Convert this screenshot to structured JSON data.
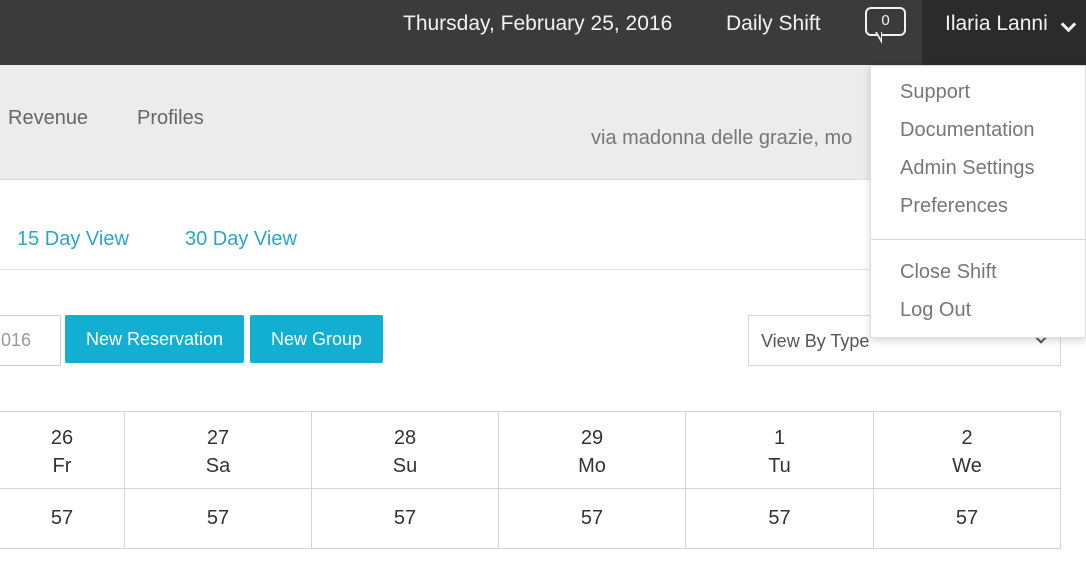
{
  "header": {
    "date": "Thursday, February 25, 2016",
    "shift": "Daily Shift",
    "messages_count": "0",
    "user_name": "Ilaria Lanni"
  },
  "nav": {
    "items": [
      {
        "label": "Revenue"
      },
      {
        "label": "Profiles"
      }
    ],
    "address": "via madonna delle grazie, mo"
  },
  "views": {
    "tabs": [
      {
        "label": "15 Day View"
      },
      {
        "label": "30 Day View"
      }
    ]
  },
  "toolbar": {
    "date_value": "016",
    "new_reservation": "New Reservation",
    "new_group": "New Group",
    "view_select": "View By Type"
  },
  "calendar": {
    "columns": [
      {
        "day": "26",
        "weekday": "Fr",
        "value": "57"
      },
      {
        "day": "27",
        "weekday": "Sa",
        "value": "57"
      },
      {
        "day": "28",
        "weekday": "Su",
        "value": "57"
      },
      {
        "day": "29",
        "weekday": "Mo",
        "value": "57"
      },
      {
        "day": "1",
        "weekday": "Tu",
        "value": "57"
      },
      {
        "day": "2",
        "weekday": "We",
        "value": "57"
      }
    ]
  },
  "user_menu": {
    "items": [
      {
        "label": "Support"
      },
      {
        "label": "Documentation"
      },
      {
        "label": "Admin Settings"
      },
      {
        "label": "Preferences"
      },
      {
        "label": "Close Shift"
      },
      {
        "label": "Log Out"
      }
    ]
  },
  "colors": {
    "topbar": "#3b3b3b",
    "accent": "#12afd3",
    "link": "#2ba6c7"
  }
}
